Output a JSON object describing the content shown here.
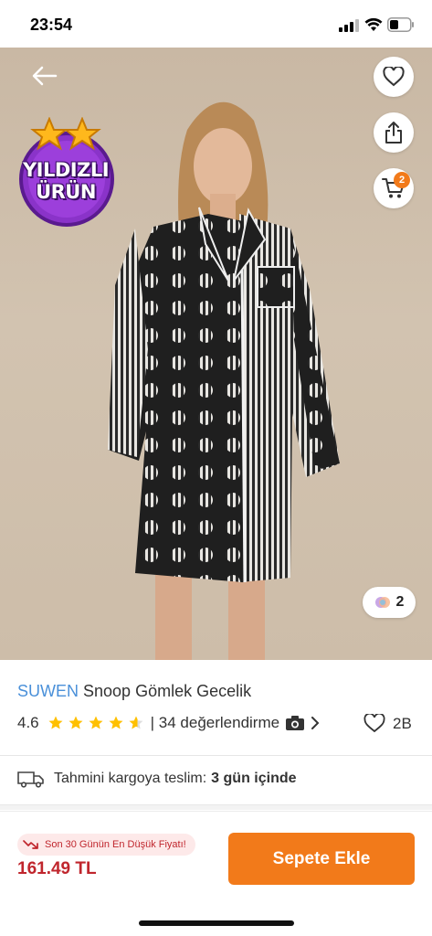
{
  "status_bar": {
    "time": "23:54"
  },
  "badges": {
    "star_line1": "YILDIZLI",
    "star_line2": "ÜRÜN",
    "cart_count": "2",
    "variant_count": "2"
  },
  "product": {
    "brand": "SUWEN",
    "name": "Snoop Gömlek Gecelik",
    "rating": "4.6",
    "rating_stars": 4.6,
    "reviews": "| 34 değerlendirme",
    "likes": "2B"
  },
  "delivery": {
    "label": "Tahmini kargoya teslim:",
    "value": "3 gün içinde"
  },
  "gallery": {
    "image_count": 5,
    "active_index": 0
  },
  "purchase": {
    "lowest_price_label": "Son 30 Günün En Düşük Fiyatı!",
    "price": "161.49 TL",
    "add_to_cart": "Sepete Ekle"
  },
  "colors": {
    "accent": "#f27a1a",
    "brand": "#4a90d9",
    "price": "#c0262d",
    "star": "#ffc000"
  },
  "icons": [
    "back-arrow-icon",
    "heart-icon",
    "share-icon",
    "cart-icon",
    "truck-icon",
    "camera-icon",
    "chevron-right-icon",
    "trend-down-icon"
  ]
}
